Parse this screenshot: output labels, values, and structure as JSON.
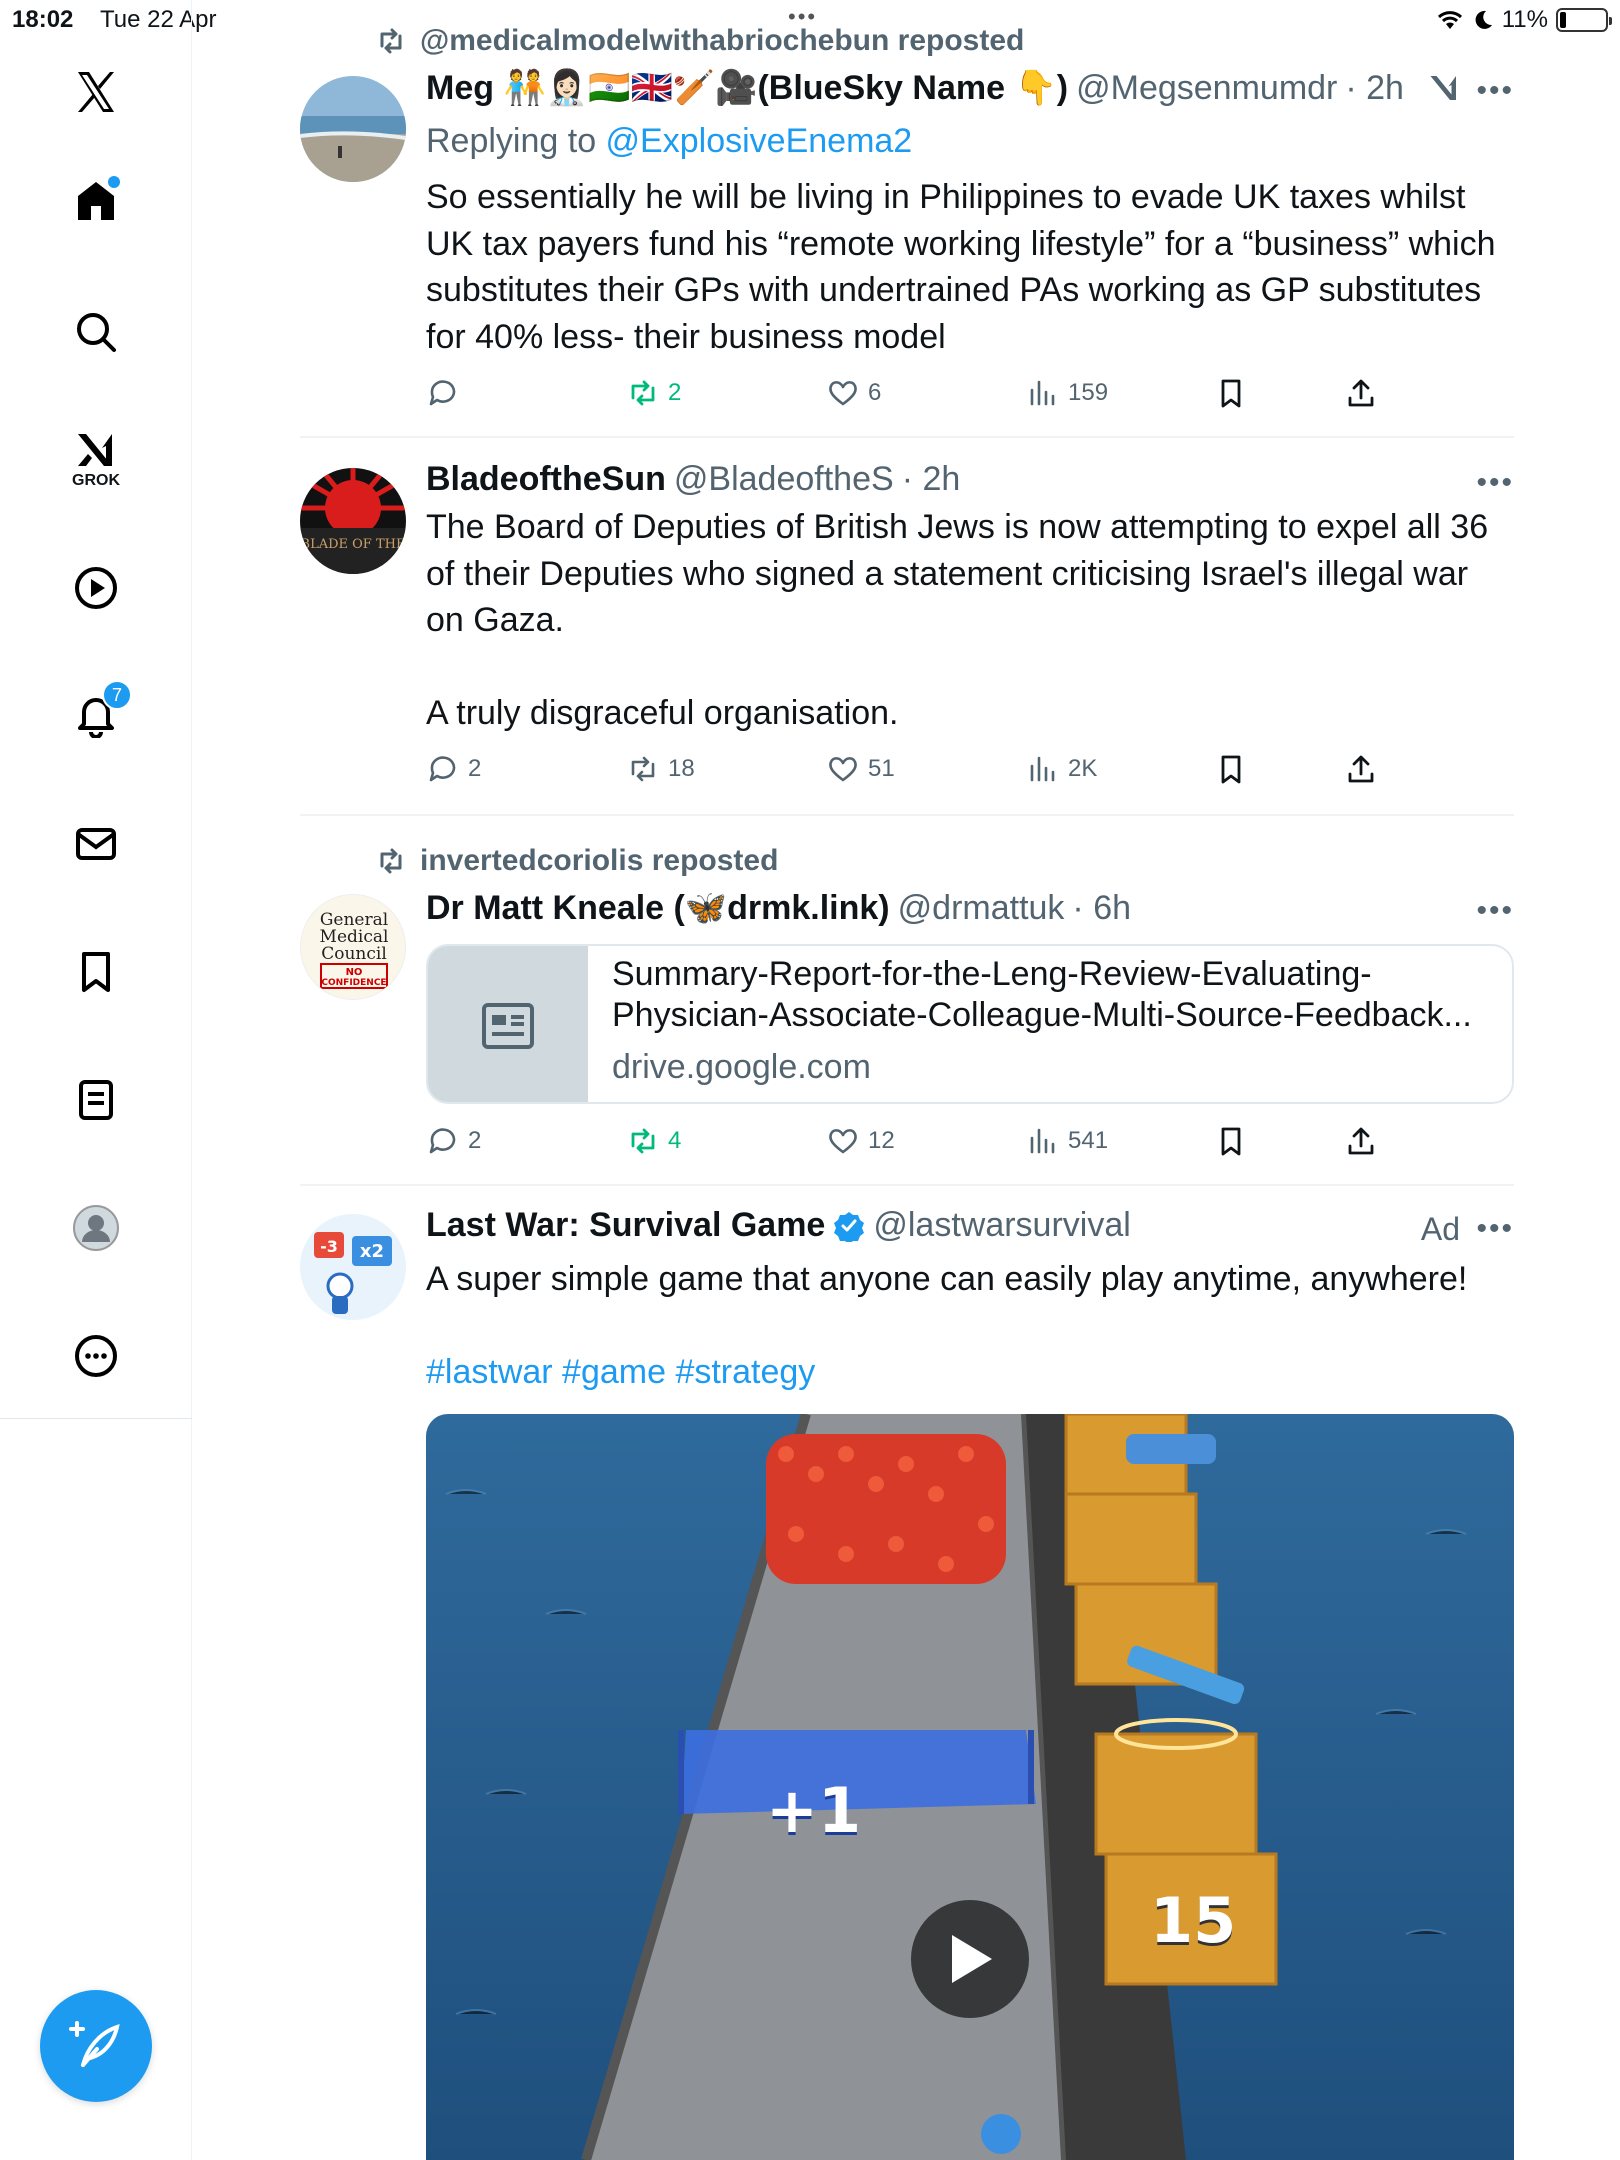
{
  "status": {
    "time": "18:02",
    "date": "Tue 22 Apr",
    "battery": "11%",
    "battery_level": 0.11
  },
  "sidebar": {
    "items": [
      {
        "name": "home",
        "label": ""
      },
      {
        "name": "search",
        "label": ""
      },
      {
        "name": "grok",
        "label": "GROK"
      },
      {
        "name": "videos",
        "label": ""
      },
      {
        "name": "notifications",
        "label": "",
        "badge": "7"
      },
      {
        "name": "messages",
        "label": ""
      },
      {
        "name": "bookmarks",
        "label": ""
      },
      {
        "name": "lists",
        "label": ""
      },
      {
        "name": "profile",
        "label": ""
      },
      {
        "name": "more",
        "label": ""
      }
    ],
    "compose_icon": "compose-icon"
  },
  "tweets": [
    {
      "repost": "@medicalmodelwithabriochebun reposted",
      "name": "Meg 🧑‍🤝‍🧑👩🏻‍⚕️🇮🇳🇬🇧🏏🎥(BlueSky Name 👇)",
      "handle": "@Megsenmumdr",
      "time": "· 2h",
      "replying_prefix": "Replying to ",
      "replying_to": "@ExplosiveEnema2",
      "text": "So essentially he will be living in Philippines to evade UK taxes whilst UK tax payers fund his “remote working lifestyle” for a “business” which substitutes their GPs with undertrained PAs working as GP substitutes for 40% less- their business model",
      "replies": "",
      "reposts": "2",
      "likes": "6",
      "views": "159"
    },
    {
      "name": "BladeoftheSun",
      "handle": "@BladeoftheS",
      "time": "· 2h",
      "avatar_text": "BLADE OF THE",
      "text": "The Board of Deputies of British Jews is now attempting to expel all 36 of their Deputies who signed a statement criticising Israel's illegal war on Gaza.\n\nA truly disgraceful organisation.",
      "replies": "2",
      "reposts": "18",
      "likes": "51",
      "views": "2K"
    },
    {
      "repost": "invertedcoriolis reposted",
      "name": "Dr Matt Kneale (🦋drmk.link)",
      "handle": "@drmattuk",
      "time": "· 6h",
      "avatar_lines": [
        "General",
        "Medical",
        "Council",
        "NO",
        "CONFIDENCE"
      ],
      "link_title": "Summary-Report-for-the-Leng-Review-Evaluating-Physician-Associate-Colleague-Multi-Source-Feedback...",
      "link_domain": "drive.google.com",
      "replies": "2",
      "reposts": "4",
      "likes": "12",
      "views": "541"
    },
    {
      "name": "Last War: Survival Game",
      "handle": "@lastwarsurvival",
      "ad": "Ad",
      "text": "A super simple game that anyone can easily play anytime, anywhere!",
      "hashtags": "#lastwar #game #strategy",
      "avatar_text": "-3 x2",
      "media_gate": "+1",
      "media_crate": "15"
    }
  ],
  "colors": {
    "accent": "#1d9bf0",
    "repost_green": "#00ba7c",
    "muted": "#536471"
  }
}
